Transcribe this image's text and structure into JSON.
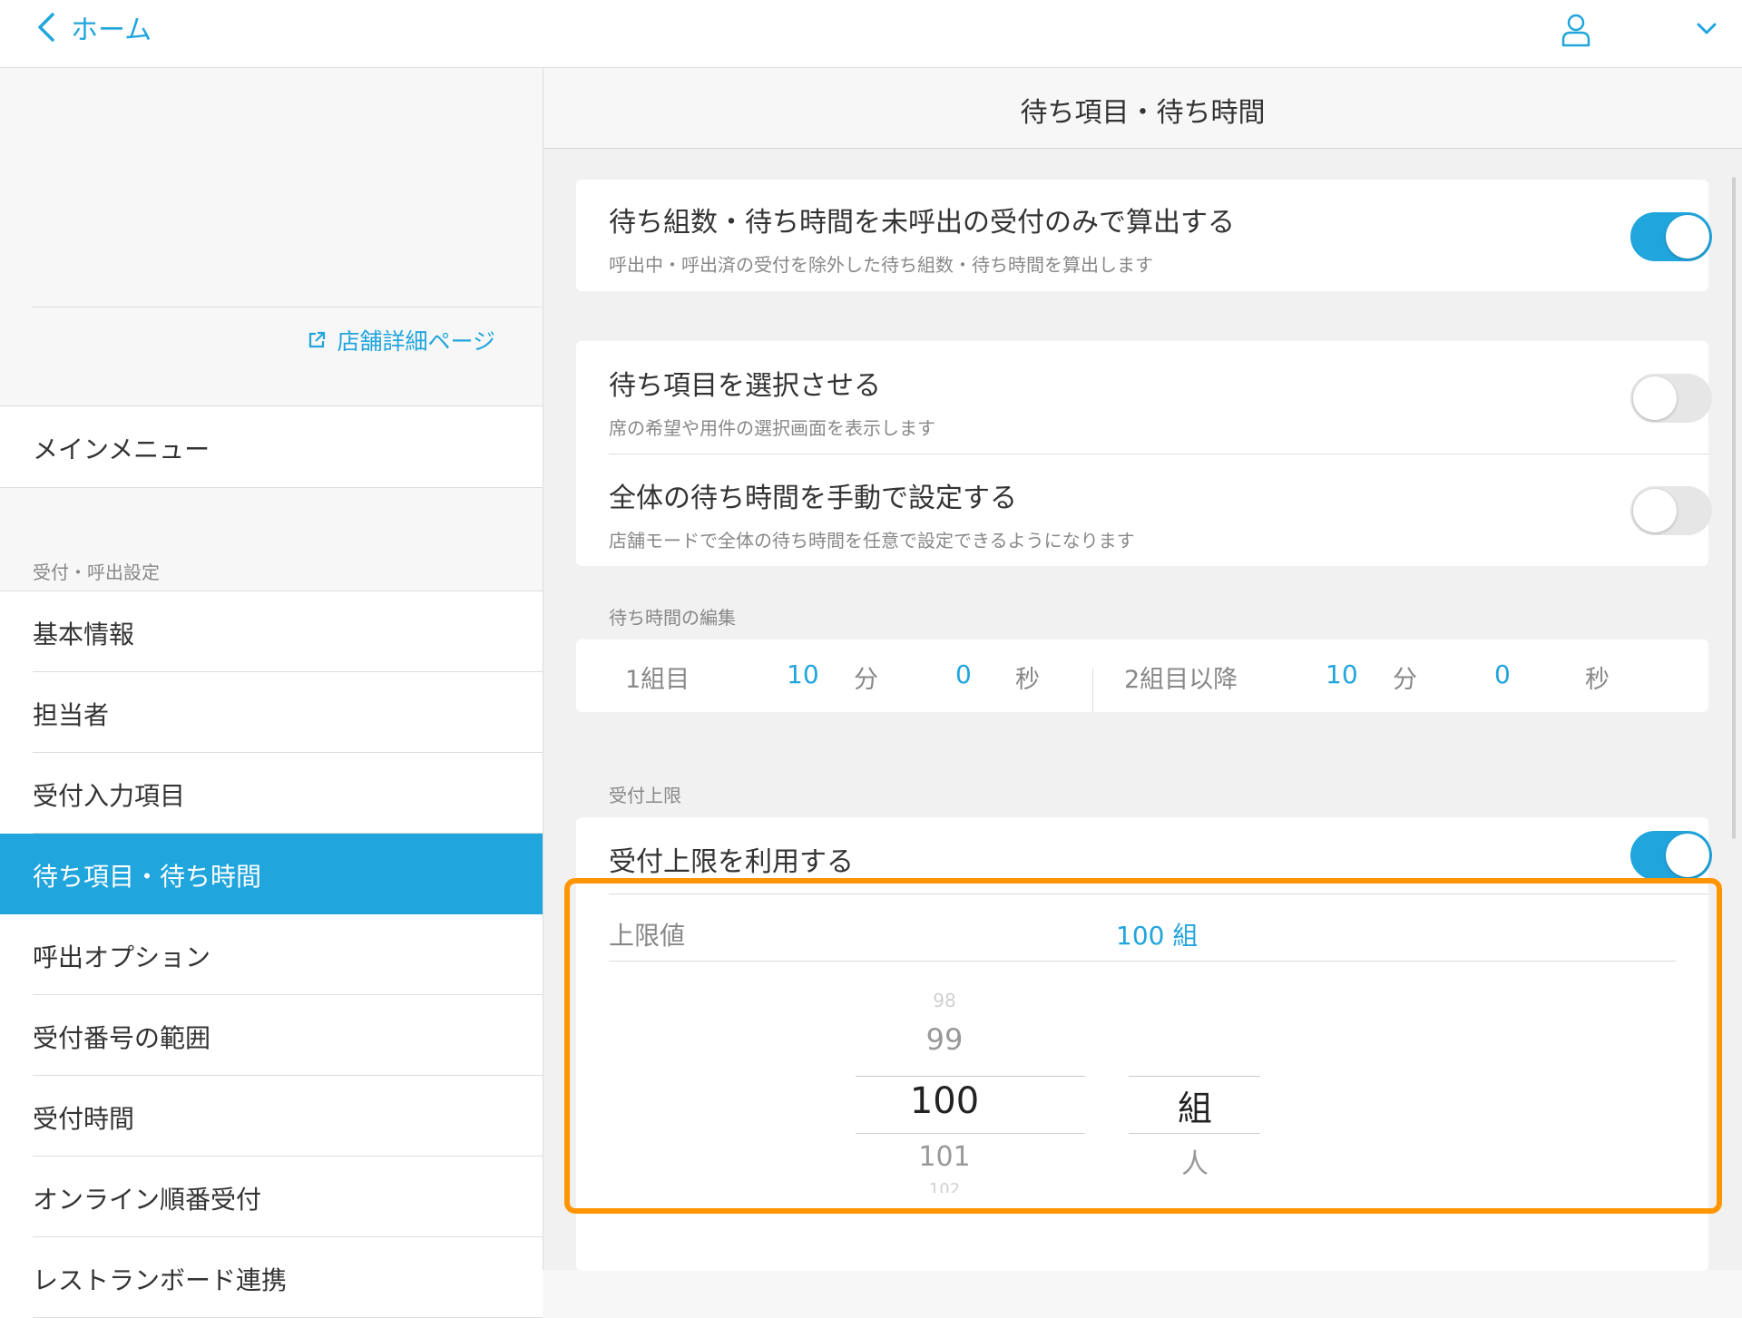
{
  "nav": {
    "back_label": "ホーム"
  },
  "sidebar": {
    "store_link": "店舗詳細ページ",
    "main_menu": "メインメニュー",
    "section_title": "受付・呼出設定",
    "items": [
      {
        "label": "基本情報",
        "active": false
      },
      {
        "label": "担当者",
        "active": false
      },
      {
        "label": "受付入力項目",
        "active": false
      },
      {
        "label": "待ち項目・待ち時間",
        "active": true
      },
      {
        "label": "呼出オプション",
        "active": false
      },
      {
        "label": "受付番号の範囲",
        "active": false
      },
      {
        "label": "受付時間",
        "active": false
      },
      {
        "label": "オンライン順番受付",
        "active": false
      },
      {
        "label": "レストランボード連携",
        "active": false
      }
    ]
  },
  "main": {
    "title": "待ち項目・待ち時間",
    "settings": {
      "uncalled_only": {
        "title": "待ち組数・待ち時間を未呼出の受付のみで算出する",
        "subtitle": "呼出中・呼出済の受付を除外した待ち組数・待ち時間を算出します",
        "enabled": true
      },
      "select_items": {
        "title": "待ち項目を選択させる",
        "subtitle": "席の希望や用件の選択画面を表示します",
        "enabled": false
      },
      "manual_wait": {
        "title": "全体の待ち時間を手動で設定する",
        "subtitle": "店舗モードで全体の待ち時間を任意で設定できるようになります",
        "enabled": false
      }
    },
    "wait_edit": {
      "section_label": "待ち時間の編集",
      "first_label": "1組目",
      "first_min": "10",
      "first_sec": "0",
      "rest_label": "2組目以降",
      "rest_min": "10",
      "rest_sec": "0",
      "min_unit": "分",
      "sec_unit": "秒"
    },
    "limit": {
      "section_label": "受付上限",
      "use_title": "受付上限を利用する",
      "enabled": true,
      "value_label": "上限値",
      "value_display": "100 組",
      "picker_numbers": [
        "98",
        "99",
        "100",
        "101",
        "102"
      ],
      "picker_units": [
        "組",
        "人"
      ]
    }
  },
  "colors": {
    "accent": "#21a5dd",
    "highlight": "#ff9500"
  }
}
